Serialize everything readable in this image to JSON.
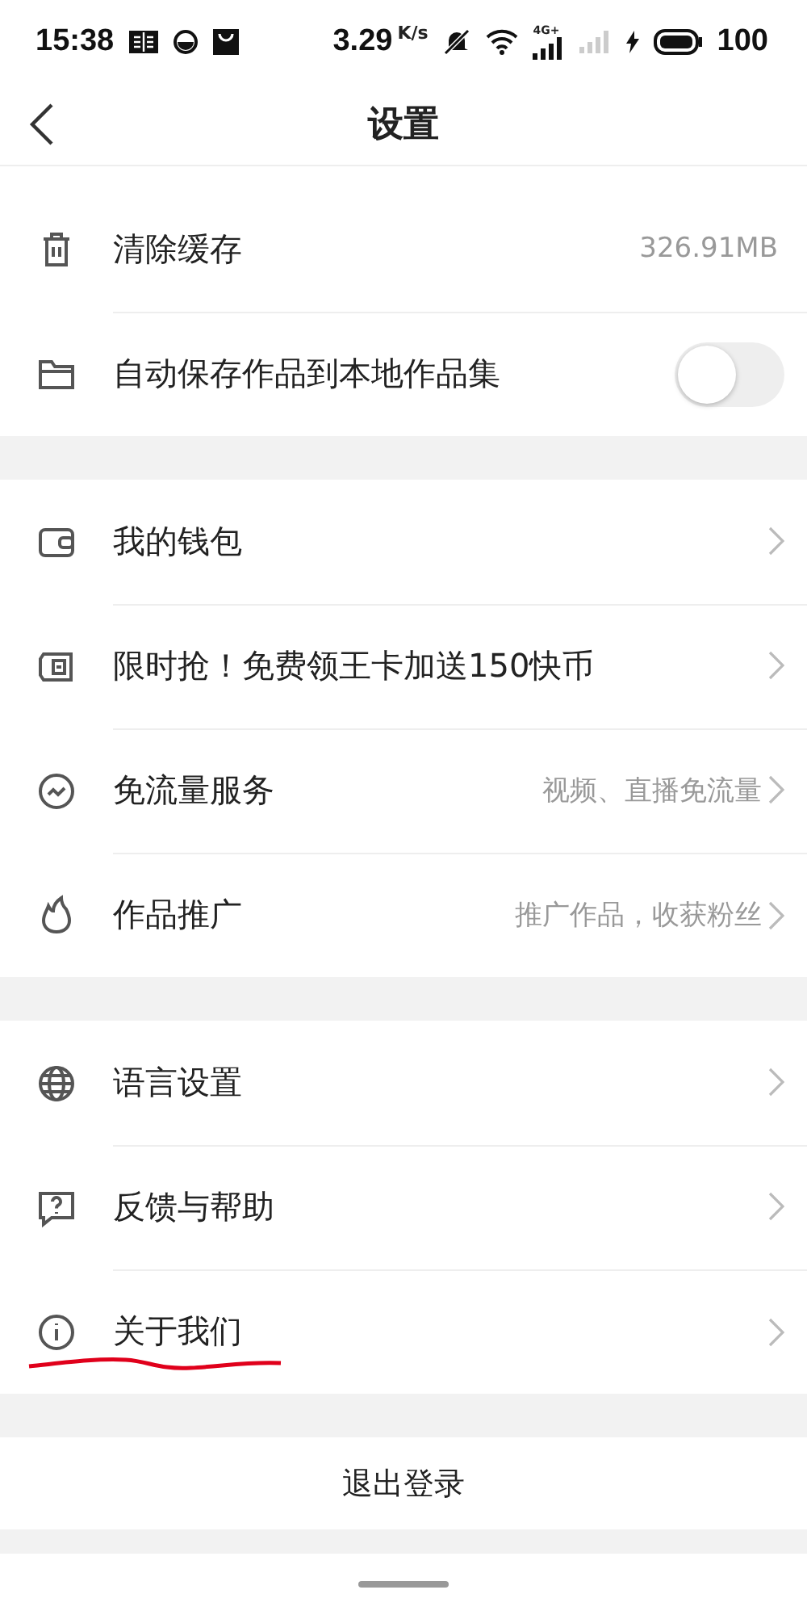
{
  "status_bar": {
    "time": "15:38",
    "speed": "3.29",
    "speed_unit": "K/s",
    "network": "4G+",
    "battery": "100"
  },
  "header": {
    "title": "设置"
  },
  "sections": [
    {
      "items": [
        {
          "kind": "value",
          "label": "清除缓存",
          "value": "326.91MB"
        },
        {
          "kind": "toggle",
          "label": "自动保存作品到本地作品集",
          "on": false
        }
      ]
    },
    {
      "items": [
        {
          "kind": "link",
          "label": "我的钱包"
        },
        {
          "kind": "link",
          "label": "限时抢！免费领王卡加送150快币"
        },
        {
          "kind": "link",
          "label": "免流量服务",
          "value": "视频、直播免流量"
        },
        {
          "kind": "link",
          "label": "作品推广",
          "value": "推广作品，收获粉丝"
        }
      ]
    },
    {
      "items": [
        {
          "kind": "link",
          "label": "语言设置"
        },
        {
          "kind": "link",
          "label": "反馈与帮助"
        },
        {
          "kind": "link",
          "label": "关于我们",
          "underlined": true
        }
      ]
    }
  ],
  "logout": "退出登录"
}
